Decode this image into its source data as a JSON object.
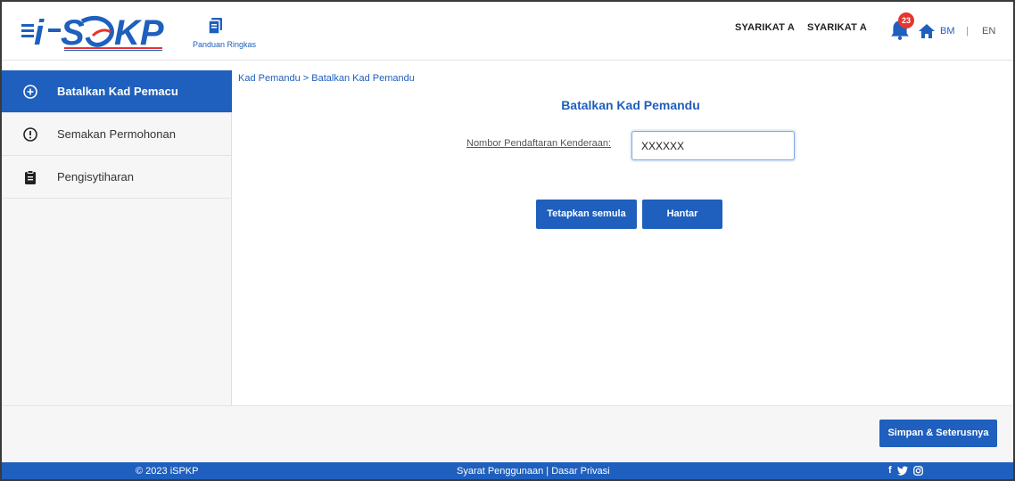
{
  "header": {
    "logo_text": "iSPKP",
    "guide_label": "Panduan Ringkas",
    "company_1": "SYARIKAT A",
    "company_2": "SYARIKAT A",
    "notification_count": "23",
    "lang_bm": "BM",
    "lang_sep": "|",
    "lang_en": "EN",
    "icons": [
      "menu-icon",
      "book-icon",
      "bell-icon",
      "home-icon"
    ]
  },
  "sidebar": {
    "items": [
      {
        "label": "Batalkan Kad Pemacu",
        "icon": "plus-circle-icon",
        "active": true
      },
      {
        "label": "Semakan Permohonan",
        "icon": "alert-circle-icon",
        "active": false
      },
      {
        "label": "Pengisytiharan",
        "icon": "clipboard-icon",
        "active": false
      }
    ]
  },
  "main": {
    "breadcrumb": "Kad Pemandu > Batalkan Kad Pemandu",
    "title": "Batalkan Kad Pemandu",
    "field_label": "Nombor Pendaftaran Kenderaan:",
    "field_value": "XXXXXX",
    "reset_label": "Tetapkan semula",
    "submit_label": "Hantar"
  },
  "bottom": {
    "next_label": "Simpan & Seterusnya"
  },
  "footer": {
    "copyright": "© 2023 iSPKP",
    "links": "Syarat Penggunaan | Dasar Privasi",
    "social": [
      "facebook-icon",
      "twitter-icon",
      "instagram-icon"
    ]
  },
  "colors": {
    "primary": "#1f5fbd",
    "badge": "#e4362f",
    "sidebar_bg": "#f6f6f6"
  }
}
